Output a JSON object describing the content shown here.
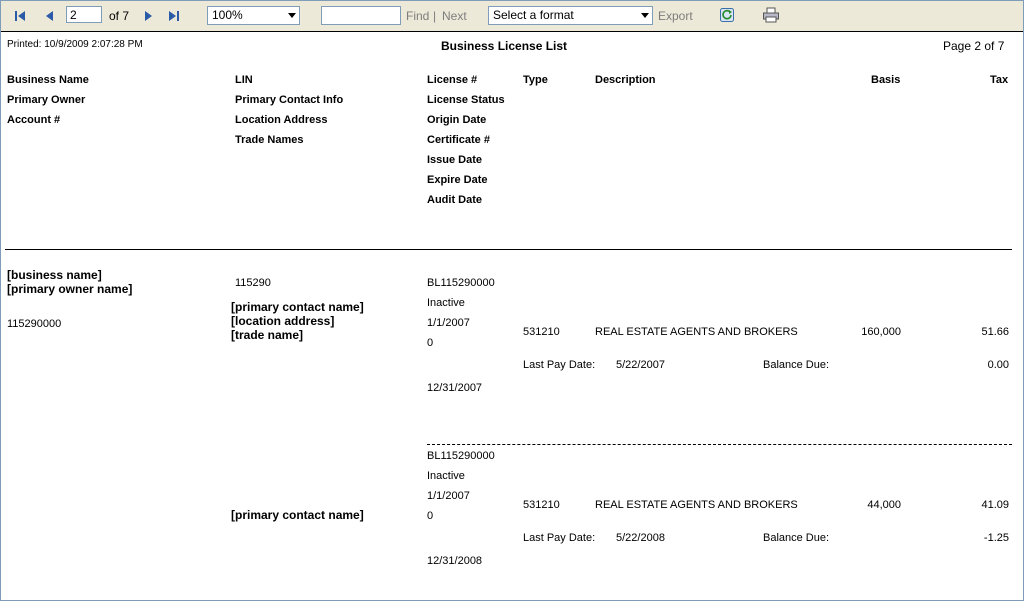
{
  "toolbar": {
    "current_page": "2",
    "of_label": "of 7",
    "zoom": "100%",
    "find_value": "",
    "find_label": "Find",
    "separator": "|",
    "next_label": "Next",
    "format_placeholder": "Select a format",
    "export_label": "Export",
    "icons": [
      "first-page-icon",
      "prev-page-icon",
      "next-page-icon",
      "last-page-icon",
      "refresh-icon",
      "print-icon"
    ]
  },
  "report": {
    "printed": "Printed: 10/9/2009 2:07:28 PM",
    "title": "Business License List",
    "page_info": "Page 2 of 7",
    "headers": {
      "col1": [
        "Business Name",
        "Primary Owner",
        "Account #"
      ],
      "col2": [
        "LIN",
        "Primary Contact Info",
        "Location Address",
        "Trade Names"
      ],
      "col3": [
        "License #",
        "License Status",
        "Origin Date",
        "Certificate #",
        "Issue Date",
        "Expire Date",
        "Audit Date"
      ],
      "type": "Type",
      "description": "Description",
      "basis": "Basis",
      "tax": "Tax"
    },
    "record": {
      "business_name": "[business name]",
      "primary_owner": "[primary owner name]",
      "account": "115290000",
      "lin": "115290",
      "contact": "[primary contact name]",
      "location": "[location address]",
      "trade": "[trade name]"
    },
    "licenses": [
      {
        "license_no": "BL115290000",
        "status": "Inactive",
        "origin": "1/1/2007",
        "certificate": "0",
        "expire": "12/31/2007",
        "type": "531210",
        "description": "REAL ESTATE AGENTS AND BROKERS",
        "basis": "160,000",
        "tax": "51.66",
        "last_pay_label": "Last Pay Date:",
        "last_pay": "5/22/2007",
        "balance_label": "Balance Due:",
        "balance": "0.00"
      },
      {
        "license_no": "BL115290000",
        "status": "Inactive",
        "origin": "1/1/2007",
        "certificate": "0",
        "expire": "12/31/2008",
        "type": "531210",
        "description": "REAL ESTATE AGENTS AND BROKERS",
        "basis": "44,000",
        "tax": "41.09",
        "last_pay_label": "Last Pay Date:",
        "last_pay": "5/22/2008",
        "balance_label": "Balance Due:",
        "balance": "-1.25",
        "contact": "[primary contact name]"
      }
    ]
  }
}
